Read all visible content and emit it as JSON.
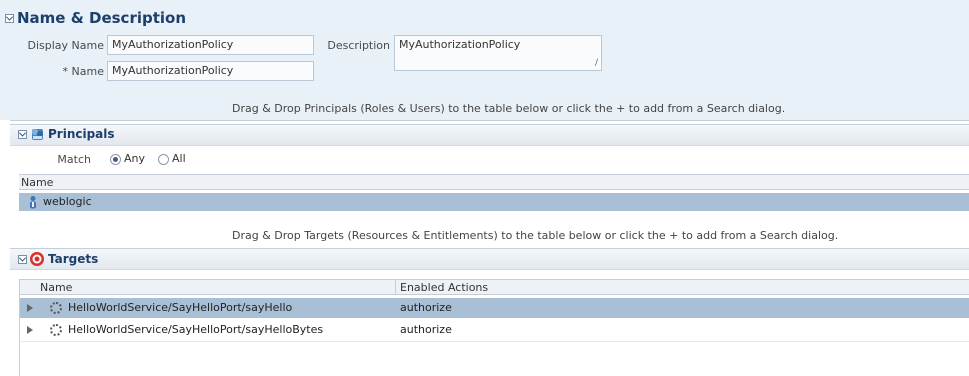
{
  "name_desc": {
    "title": "Name & Description",
    "display_name_label": "Display Name",
    "display_name_value": "MyAuthorizationPolicy",
    "name_label": "* Name",
    "name_value": "MyAuthorizationPolicy",
    "description_label": "Description",
    "description_value": "MyAuthorizationPolicy"
  },
  "principals_hint": "Drag & Drop Principals (Roles & Users) to the table below or click the + to add from a Search dialog.",
  "principals": {
    "title": "Principals",
    "match_label": "Match",
    "options": [
      "Any",
      "All"
    ],
    "selected": "Any",
    "column": "Name",
    "rows": [
      "weblogic"
    ]
  },
  "targets_hint": "Drag & Drop Targets (Resources & Entitlements) to the table below or click the + to add from a Search dialog.",
  "targets": {
    "title": "Targets",
    "columns": [
      "Name",
      "Enabled Actions"
    ],
    "rows": [
      {
        "name": "HelloWorldService/SayHelloPort/sayHello",
        "action": "authorize"
      },
      {
        "name": "HelloWorldService/SayHelloPort/sayHelloBytes",
        "action": "authorize"
      }
    ]
  },
  "colors": {
    "panel_bg": "#e8f1f8",
    "header_text": "#1d3f6b",
    "selection": "#a9bfd6"
  },
  "icons": {
    "principals": "principals-group-icon",
    "targets": "targets-icon",
    "user": "user-icon",
    "resource": "gear-icon"
  }
}
